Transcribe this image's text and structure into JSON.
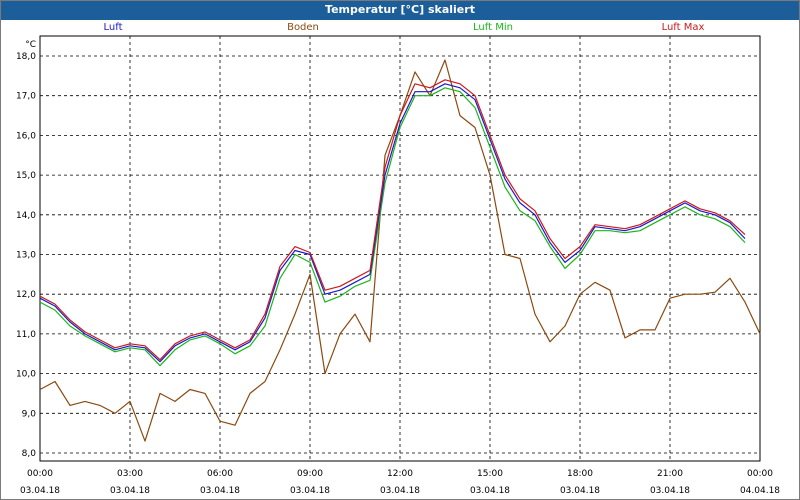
{
  "title": "Temperatur [°C] skaliert",
  "chart_data": {
    "type": "line",
    "title": "Temperatur [°C] skaliert",
    "ylabel": "°C",
    "xlabel": "",
    "ylim": [
      8.0,
      18.0
    ],
    "xlim": [
      0,
      24
    ],
    "grid": true,
    "legend_position": "top",
    "yticks": [
      "8,0",
      "9,0",
      "10,0",
      "11,0",
      "12,0",
      "13,0",
      "14,0",
      "15,0",
      "16,0",
      "17,0",
      "18,0"
    ],
    "xticks": [
      {
        "time": "00:00",
        "date": "03.04.18"
      },
      {
        "time": "03:00",
        "date": "03.04.18"
      },
      {
        "time": "06:00",
        "date": "03.04.18"
      },
      {
        "time": "09:00",
        "date": "03.04.18"
      },
      {
        "time": "12:00",
        "date": "03.04.18"
      },
      {
        "time": "15:00",
        "date": "03.04.18"
      },
      {
        "time": "18:00",
        "date": "03.04.18"
      },
      {
        "time": "21:00",
        "date": "03.04.18"
      },
      {
        "time": "00:00",
        "date": "04.04.18"
      }
    ],
    "series": [
      {
        "name": "Luft",
        "color": "#1a1ad0",
        "x": [
          0,
          0.5,
          1,
          1.5,
          2,
          2.5,
          3,
          3.5,
          4,
          4.5,
          5,
          5.5,
          6,
          6.5,
          7,
          7.5,
          8,
          8.5,
          9,
          9.5,
          10,
          10.5,
          11,
          11.5,
          12,
          12.5,
          13,
          13.5,
          14,
          14.5,
          15,
          15.5,
          16,
          16.5,
          17,
          17.5,
          18,
          18.5,
          19,
          19.5,
          20,
          20.5,
          21,
          21.5,
          22,
          22.5,
          23,
          23.5
        ],
        "values": [
          11.9,
          11.7,
          11.3,
          11.0,
          10.8,
          10.6,
          10.7,
          10.65,
          10.3,
          10.7,
          10.9,
          11.0,
          10.8,
          10.6,
          10.8,
          11.4,
          12.6,
          13.1,
          13.0,
          12.0,
          12.1,
          12.3,
          12.5,
          15.0,
          16.3,
          17.1,
          17.1,
          17.3,
          17.2,
          16.9,
          15.9,
          14.9,
          14.3,
          14.0,
          13.3,
          12.8,
          13.1,
          13.7,
          13.65,
          13.6,
          13.7,
          13.9,
          14.1,
          14.3,
          14.1,
          14.0,
          13.8,
          13.4
        ]
      },
      {
        "name": "Boden",
        "color": "#8b4a10",
        "x": [
          0,
          0.5,
          1,
          1.5,
          2,
          2.5,
          3,
          3.5,
          4,
          4.5,
          5,
          5.5,
          6,
          6.5,
          7,
          7.5,
          8,
          8.5,
          9,
          9.5,
          10,
          10.5,
          11,
          11.5,
          12,
          12.5,
          13,
          13.5,
          14,
          14.5,
          15,
          15.5,
          16,
          16.5,
          17,
          17.5,
          18,
          18.5,
          19,
          19.5,
          20,
          20.5,
          21,
          21.5,
          22,
          22.5,
          23,
          23.5,
          24
        ],
        "values": [
          9.6,
          9.8,
          9.2,
          9.3,
          9.2,
          9.0,
          9.3,
          8.3,
          9.5,
          9.3,
          9.6,
          9.5,
          8.8,
          8.7,
          9.5,
          9.8,
          10.6,
          11.5,
          12.5,
          10.0,
          11.0,
          11.5,
          10.8,
          15.5,
          16.5,
          17.6,
          17.0,
          17.9,
          16.5,
          16.2,
          15.0,
          13.0,
          12.9,
          11.5,
          10.8,
          11.2,
          12.0,
          12.3,
          12.1,
          10.9,
          11.1,
          11.1,
          11.9,
          12.0,
          12.0,
          12.05,
          12.4,
          11.8,
          11.0
        ]
      },
      {
        "name": "Luft Min",
        "color": "#1bb51b",
        "x": [
          0,
          0.5,
          1,
          1.5,
          2,
          2.5,
          3,
          3.5,
          4,
          4.5,
          5,
          5.5,
          6,
          6.5,
          7,
          7.5,
          8,
          8.5,
          9,
          9.5,
          10,
          10.5,
          11,
          11.5,
          12,
          12.5,
          13,
          13.5,
          14,
          14.5,
          15,
          15.5,
          16,
          16.5,
          17,
          17.5,
          18,
          18.5,
          19,
          19.5,
          20,
          20.5,
          21,
          21.5,
          22,
          22.5,
          23,
          23.5
        ],
        "values": [
          11.8,
          11.6,
          11.2,
          10.95,
          10.75,
          10.55,
          10.65,
          10.6,
          10.2,
          10.6,
          10.85,
          10.95,
          10.75,
          10.5,
          10.7,
          11.2,
          12.4,
          13.0,
          12.8,
          11.8,
          11.95,
          12.2,
          12.35,
          14.8,
          16.2,
          17.0,
          17.0,
          17.2,
          17.1,
          16.7,
          15.7,
          14.7,
          14.1,
          13.85,
          13.2,
          12.65,
          13.0,
          13.6,
          13.6,
          13.55,
          13.6,
          13.8,
          14.0,
          14.2,
          14.0,
          13.9,
          13.7,
          13.3
        ]
      },
      {
        "name": "Luft Max",
        "color": "#cc1a1a",
        "x": [
          0,
          0.5,
          1,
          1.5,
          2,
          2.5,
          3,
          3.5,
          4,
          4.5,
          5,
          5.5,
          6,
          6.5,
          7,
          7.5,
          8,
          8.5,
          9,
          9.5,
          10,
          10.5,
          11,
          11.5,
          12,
          12.5,
          13,
          13.5,
          14,
          14.5,
          15,
          15.5,
          16,
          16.5,
          17,
          17.5,
          18,
          18.5,
          19,
          19.5,
          20,
          20.5,
          21,
          21.5,
          22,
          22.5,
          23,
          23.5
        ],
        "values": [
          11.95,
          11.75,
          11.35,
          11.05,
          10.85,
          10.65,
          10.75,
          10.7,
          10.35,
          10.75,
          10.95,
          11.05,
          10.85,
          10.65,
          10.85,
          11.5,
          12.7,
          13.2,
          13.05,
          12.1,
          12.2,
          12.4,
          12.6,
          15.2,
          16.5,
          17.3,
          17.2,
          17.4,
          17.3,
          17.0,
          16.0,
          15.0,
          14.4,
          14.1,
          13.4,
          12.9,
          13.2,
          13.75,
          13.7,
          13.65,
          13.75,
          13.95,
          14.15,
          14.35,
          14.15,
          14.05,
          13.85,
          13.5
        ]
      }
    ]
  }
}
